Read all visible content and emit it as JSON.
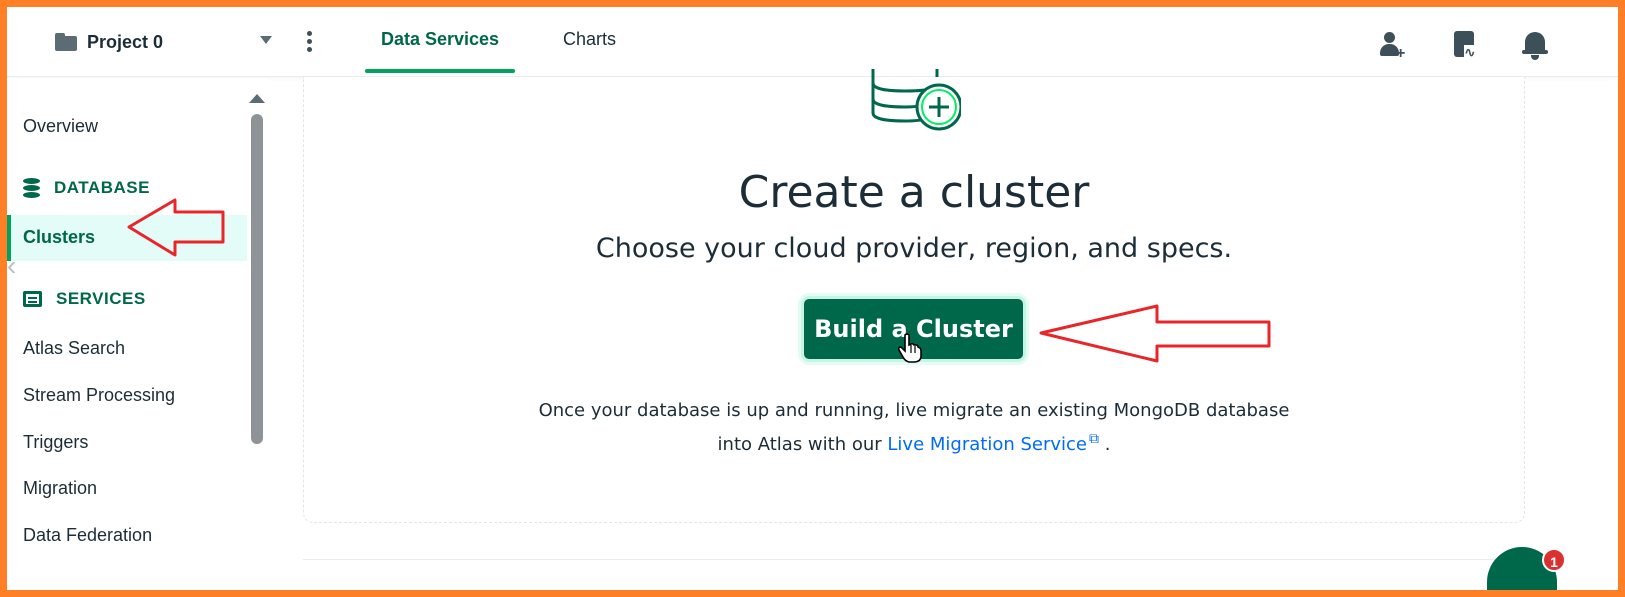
{
  "header": {
    "project_name": "Project 0",
    "tabs": [
      {
        "label": "Data Services",
        "active": true
      },
      {
        "label": "Charts",
        "active": false
      }
    ],
    "icons": [
      "user-plus-icon",
      "activity-feed-icon",
      "bell-icon"
    ]
  },
  "sidebar": {
    "overview": "Overview",
    "database_heading": "DATABASE",
    "clusters": "Clusters",
    "services_heading": "SERVICES",
    "services": [
      "Atlas Search",
      "Stream Processing",
      "Triggers",
      "Migration",
      "Data Federation"
    ]
  },
  "main": {
    "title": "Create a cluster",
    "subtitle": "Choose your cloud provider, region, and specs.",
    "build_button": "Build a Cluster",
    "info_line1": "Once your database is up and running, live migrate an existing MongoDB database",
    "info_line2_prefix": "into Atlas with our ",
    "info_link": "Live Migration Service",
    "info_line2_suffix": " ."
  },
  "chat": {
    "badge_count": "1"
  },
  "colors": {
    "brand_green": "#00684a",
    "accent_green": "#00a35c",
    "link_blue": "#016bf8",
    "annotation_red": "#e8262a",
    "frame_orange": "#ff7f27"
  }
}
